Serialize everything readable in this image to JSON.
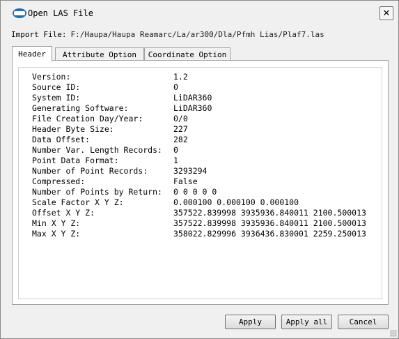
{
  "window": {
    "title": "Open LAS File",
    "close_symbol": "✕"
  },
  "import": {
    "label": "Import File:",
    "path": "F:/Haupa/Haupa Reamarc/La/ar300/Dla/Pfmh Lias/Plaf7.las"
  },
  "tabs": [
    {
      "label": "Header",
      "active": true
    },
    {
      "label": "Attribute Option",
      "active": false
    },
    {
      "label": "Coordinate Option",
      "active": false
    }
  ],
  "header_info": [
    {
      "label": "Version:",
      "value": "1.2"
    },
    {
      "label": "Source ID:",
      "value": "0"
    },
    {
      "label": "System ID:",
      "value": "LiDAR360"
    },
    {
      "label": "Generating Software:",
      "value": "LiDAR360"
    },
    {
      "label": "File Creation Day/Year:",
      "value": "0/0"
    },
    {
      "label": "Header Byte Size:",
      "value": "227"
    },
    {
      "label": "Data Offset:",
      "value": "282"
    },
    {
      "label": "Number Var. Length Records:",
      "value": "0"
    },
    {
      "label": "Point Data Format:",
      "value": "1"
    },
    {
      "label": "Number of Point Records:",
      "value": "3293294"
    },
    {
      "label": "Compressed:",
      "value": "False"
    },
    {
      "label": "Number of Points by Return:",
      "value": "0 0 0 0 0"
    },
    {
      "label": "Scale Factor X Y Z:",
      "value": "0.000100 0.000100 0.000100"
    },
    {
      "label": "Offset X Y Z:",
      "value": "357522.839998 3935936.840011 2100.500013"
    },
    {
      "label": "Min X Y Z:",
      "value": "357522.839998 3935936.840011 2100.500013"
    },
    {
      "label": "Max X Y Z:",
      "value": "358022.829996 3936436.830001 2259.250013"
    }
  ],
  "buttons": {
    "apply": "Apply",
    "apply_all": "Apply all",
    "cancel": "Cancel"
  },
  "colors": {
    "logo": "#1e6fb8"
  }
}
